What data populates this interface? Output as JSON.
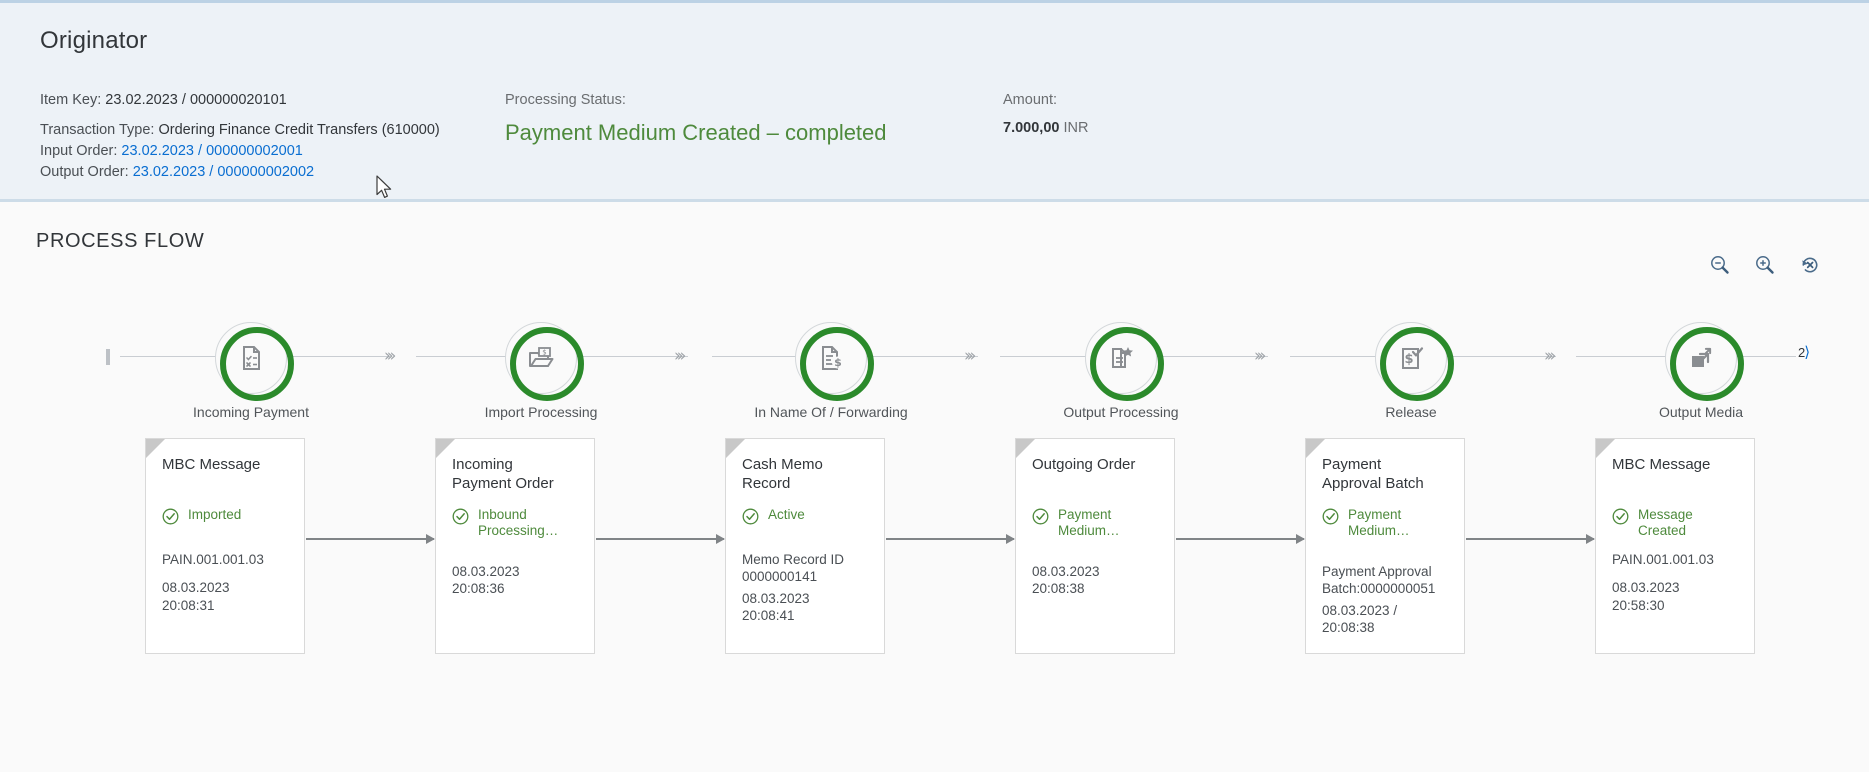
{
  "header": {
    "title": "Originator",
    "item_key_label": "Item Key:",
    "item_key_value": "23.02.2023 / 000000020101",
    "transaction_type_label": "Transaction Type:",
    "transaction_type_value": "Ordering Finance Credit Transfers (610000)",
    "input_order_label": "Input Order:",
    "input_order_value": "23.02.2023 / 000000002001",
    "output_order_label": "Output Order:",
    "output_order_value": "23.02.2023 / 000000002002",
    "processing_status_label": "Processing Status:",
    "processing_status_value": "Payment Medium Created – completed",
    "amount_label": "Amount:",
    "amount_value": "7.000,00",
    "amount_currency": "INR",
    "status_color": "#4e8a3c",
    "link_color": "#0a6ed1"
  },
  "section": {
    "title": "PROCESS FLOW",
    "node_ring_color": "#2b8a2b"
  },
  "zoom_controls": [
    {
      "name": "zoom-out-icon",
      "label": "Zoom Out"
    },
    {
      "name": "zoom-in-icon",
      "label": "Zoom In"
    },
    {
      "name": "reset-zoom-icon",
      "label": "Reset Zoom"
    }
  ],
  "flow": {
    "start_marker": "|",
    "next_page_number": "2",
    "nodes": [
      {
        "label": "Incoming Payment",
        "icon": "document-checklist-icon"
      },
      {
        "label": "Import Processing",
        "icon": "folder-money-icon"
      },
      {
        "label": "In Name Of / Forwarding",
        "icon": "document-dollar-icon"
      },
      {
        "label": "Output Processing",
        "icon": "document-star-icon"
      },
      {
        "label": "Release",
        "icon": "document-dollar-check-icon"
      },
      {
        "label": "Output Media",
        "icon": "square-arrow-out-icon"
      }
    ]
  },
  "cards": [
    {
      "title": "MBC Message",
      "status": "Imported",
      "meta": [
        "PAIN.001.001.03",
        "08.03.2023\n20:08:31"
      ]
    },
    {
      "title": "Incoming\nPayment Order",
      "status": "Inbound\nProcessing…",
      "meta": [
        "08.03.2023\n20:08:36"
      ]
    },
    {
      "title": "Cash Memo\nRecord",
      "status": "Active",
      "meta": [
        "Memo Record ID\n0000000141",
        "08.03.2023\n20:08:41"
      ]
    },
    {
      "title": "Outgoing Order",
      "status": "Payment\nMedium…",
      "meta": [
        "08.03.2023\n20:08:38"
      ]
    },
    {
      "title": "Payment\nApproval Batch",
      "status": "Payment\nMedium…",
      "meta": [
        "Payment Approval\nBatch:0000000051",
        "08.03.2023 /\n20:08:38"
      ]
    },
    {
      "title": "MBC Message",
      "status": "Message\nCreated",
      "meta": [
        "PAIN.001.001.03",
        "08.03.2023\n20:58:30"
      ]
    }
  ]
}
